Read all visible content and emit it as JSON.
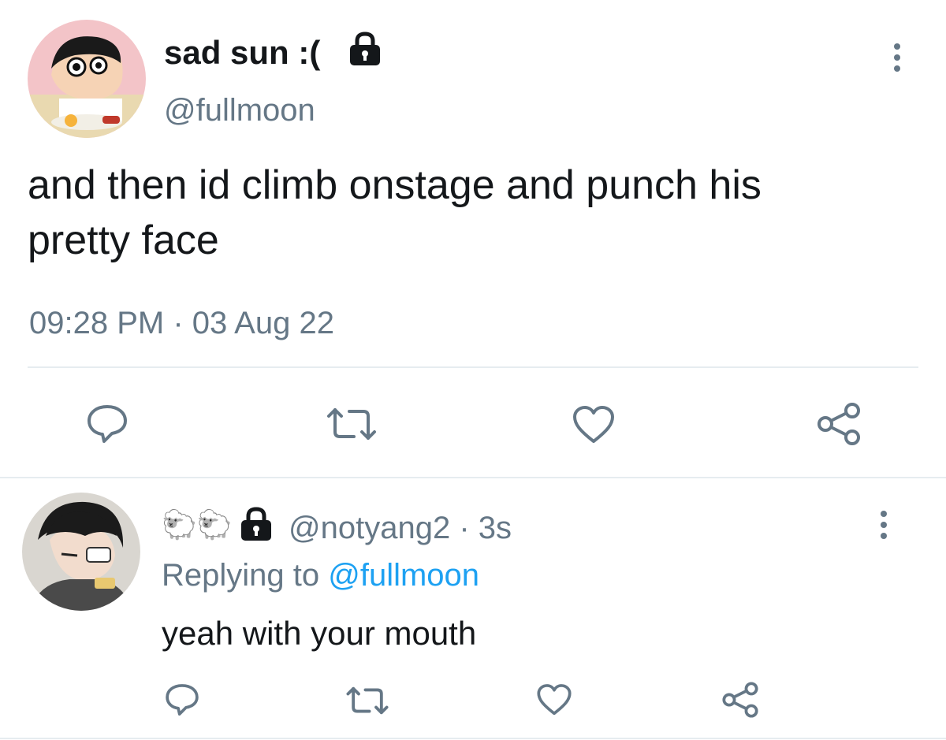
{
  "main_tweet": {
    "display_name": "sad sun :(",
    "handle": "@fullmoon",
    "text_line1": "and then id climb onstage and punch his",
    "text_line2": "pretty face",
    "timestamp": "09:28 PM · 03 Aug 22",
    "icons": [
      "lock-icon",
      "more-icon",
      "reply-icon",
      "retweet-icon",
      "like-icon",
      "share-icon"
    ]
  },
  "reply_tweet": {
    "display_name": "🐑🐑",
    "handle": "@notyang2",
    "time": "3s",
    "replying_label": "Replying to",
    "replying_to": "@fullmoon",
    "text": "yeah with your mouth",
    "icons": [
      "lock-icon",
      "more-icon",
      "reply-icon",
      "retweet-icon",
      "like-icon",
      "share-icon"
    ]
  },
  "colors": {
    "text": "#14171a",
    "secondary": "#657786",
    "link": "#1da1f2",
    "divider": "#e6ecf0"
  }
}
